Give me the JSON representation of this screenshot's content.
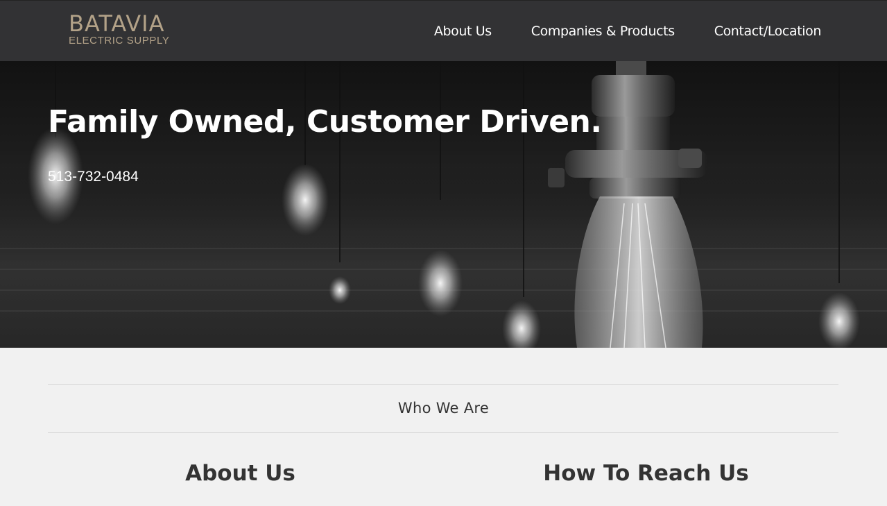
{
  "header": {
    "logo": {
      "main": "BATAVIA",
      "sub": "ELECTRIC SUPPLY"
    },
    "nav": [
      {
        "label": "About Us"
      },
      {
        "label": "Companies & Products"
      },
      {
        "label": "Contact/Location"
      }
    ]
  },
  "hero": {
    "title": "Family Owned, Customer Driven.",
    "phone": "513-732-0484"
  },
  "content": {
    "section_label": "Who We Are",
    "columns": [
      {
        "heading": "About Us"
      },
      {
        "heading": "How To Reach Us"
      }
    ]
  },
  "colors": {
    "topbar": "#323234",
    "logo": "#b3a288",
    "page_background": "#f1f1f1",
    "heading_text": "#333333"
  }
}
